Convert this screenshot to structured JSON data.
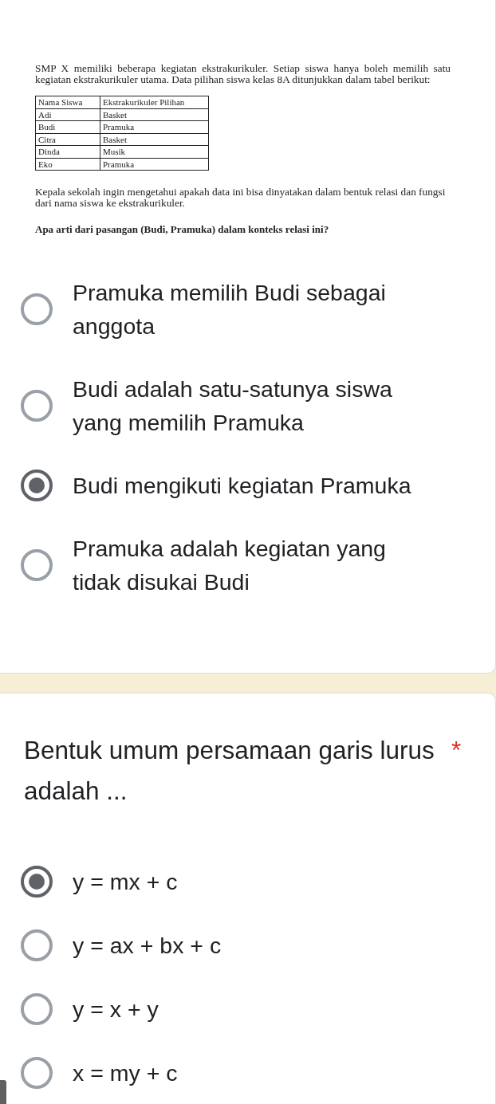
{
  "questions": [
    {
      "kind": "document",
      "document": {
        "intro": "SMP X memiliki beberapa kegiatan ekstrakurikuler. Setiap siswa hanya boleh memilih satu kegiatan ekstrakurikuler utama. Data pilihan siswa kelas 8A ditunjukkan dalam tabel berikut:",
        "table": {
          "columns": [
            "Nama Siswa",
            "Ekstrakurikuler Pilihan"
          ],
          "rows": [
            [
              "Adi",
              "Basket"
            ],
            [
              "Budi",
              "Pramuka"
            ],
            [
              "Citra",
              "Basket"
            ],
            [
              "Dinda",
              "Musik"
            ],
            [
              "Eko",
              "Pramuka"
            ]
          ]
        },
        "context": "Kepala sekolah ingin mengetahui apakah data ini bisa dinyatakan dalam bentuk relasi dan fungsi dari nama siswa ke ekstrakurikuler.",
        "prompt": "Apa arti dari pasangan (Budi, Pramuka) dalam konteks relasi ini?"
      },
      "options": [
        {
          "label": "Pramuka memilih Budi sebagai anggota",
          "selected": false
        },
        {
          "label": "Budi adalah satu-satunya siswa yang memilih Pramuka",
          "selected": false
        },
        {
          "label": "Budi mengikuti kegiatan Pramuka",
          "selected": true
        },
        {
          "label": "Pramuka adalah kegiatan yang tidak disukai Budi",
          "selected": false
        }
      ]
    },
    {
      "kind": "title",
      "title": "Bentuk umum persamaan garis lurus adalah ...",
      "required_marker": "*",
      "options": [
        {
          "label": "y = mx + c",
          "selected": true
        },
        {
          "label": "y = ax + bx + c",
          "selected": false
        },
        {
          "label": "y = x + y",
          "selected": false
        },
        {
          "label": "x = my + c",
          "selected": false
        }
      ]
    }
  ]
}
